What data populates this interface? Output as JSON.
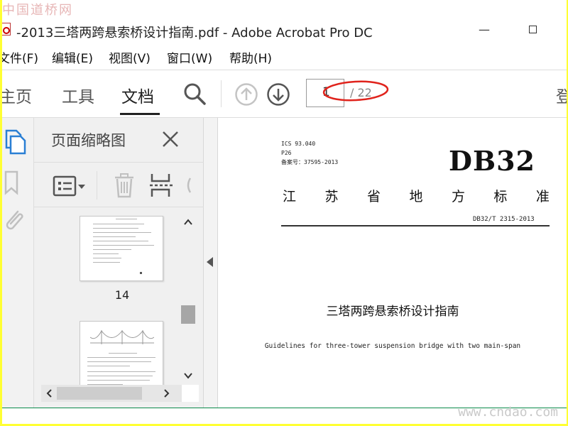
{
  "watermark": {
    "top": "中国道桥网",
    "bottom": "www.cndao.com"
  },
  "window": {
    "title": "-2013三塔两跨悬索桥设计指南.pdf - Adobe Acrobat Pro DC",
    "minimize_symbol": "—"
  },
  "menu": [
    "文件(F)",
    "编辑(E)",
    "视图(V)",
    "窗口(W)",
    "帮助(H)"
  ],
  "toolbar": {
    "tabs": [
      "主页",
      "工具",
      "文档"
    ],
    "active_tab": "文档",
    "page_current": "1",
    "page_total": "/ 22",
    "login_label": "登"
  },
  "thumbnails": {
    "title": "页面缩略图",
    "pages": [
      {
        "label": "14"
      }
    ]
  },
  "document": {
    "ics": "ICS 93.040",
    "ccs": "P26",
    "record": "备案号：37595-2013",
    "logo": "DB32",
    "standard_chars": [
      "江",
      "苏",
      "省",
      "地",
      "方",
      "标",
      "准"
    ],
    "code": "DB32/T 2315-2013",
    "title_cn": "三塔两跨悬索桥设计指南",
    "title_en": "Guidelines for three-tower suspension bridge with two main-span"
  },
  "colors": {
    "highlight_oval": "#e0231c",
    "outer_frame": "#ffff33",
    "bottom_rule": "#0a8a4a"
  }
}
